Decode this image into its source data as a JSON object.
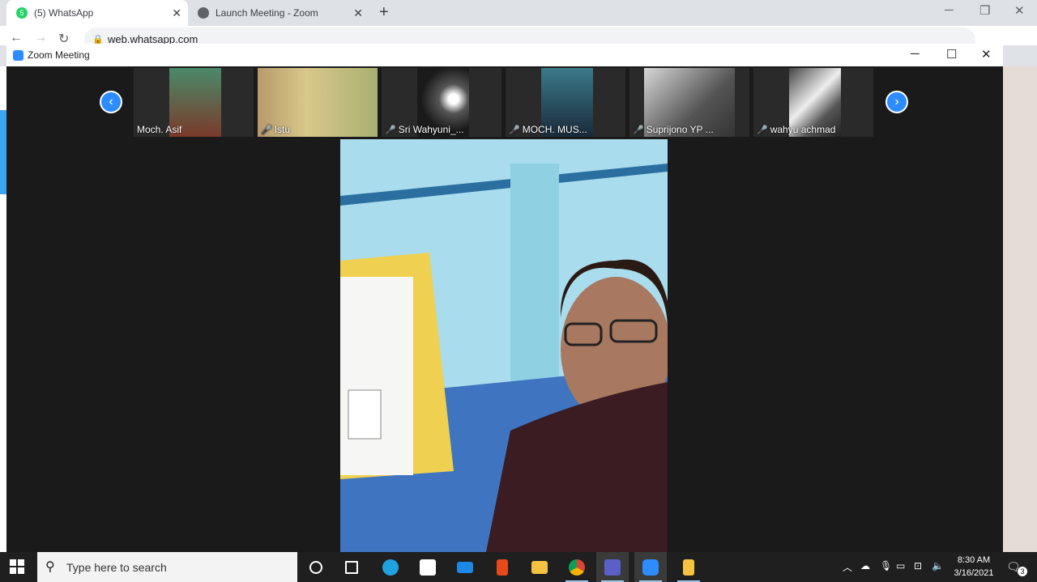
{
  "browser": {
    "tabs": [
      {
        "label": "(5) WhatsApp",
        "badge": "5"
      },
      {
        "label": "Launch Meeting - Zoom"
      }
    ],
    "url": "web.whatsapp.com",
    "new_tab": "+",
    "close_glyph": "✕"
  },
  "zoom": {
    "window_title": "Zoom Meeting",
    "participants": [
      {
        "name": "Moch. Asif",
        "muted": false
      },
      {
        "name": "Istu",
        "muted": true
      },
      {
        "name": "Sri Wahyuni_...",
        "muted": true
      },
      {
        "name": "MOCH. MUS...",
        "muted": true
      },
      {
        "name": "Suprijono YP ...",
        "muted": true
      },
      {
        "name": "wahyu achmad",
        "muted": true
      }
    ],
    "prev_arrow": "‹",
    "next_arrow": "›"
  },
  "taskbar": {
    "search_placeholder": "Type here to search",
    "time": "8:30 AM",
    "date": "3/16/2021",
    "notification_count": "3"
  },
  "colors": {
    "zoom_blue": "#2d8cff",
    "mute_red": "#e0352e",
    "taskbar": "#1f1f1f"
  }
}
